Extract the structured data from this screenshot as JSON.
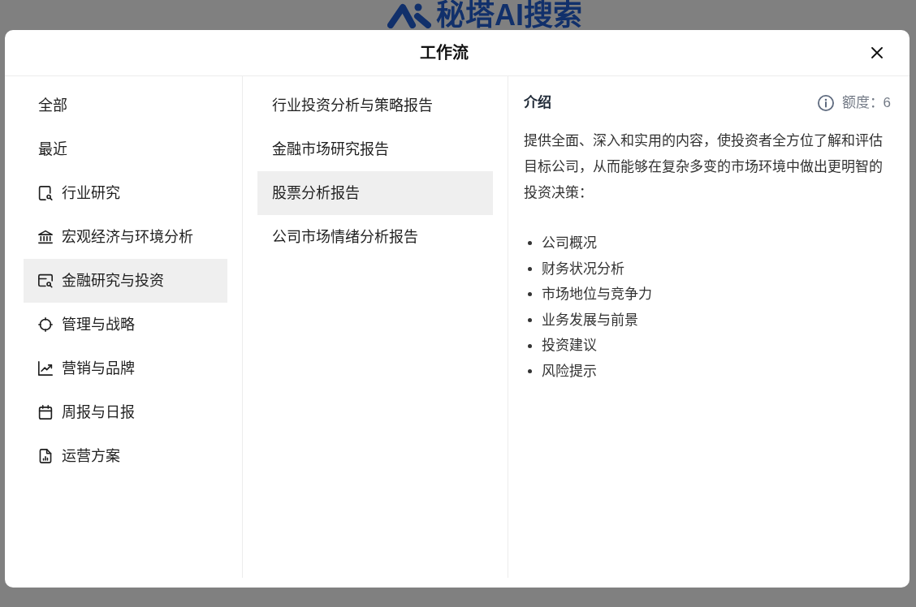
{
  "backdrop": {
    "logo_text": "秘塔AI搜索"
  },
  "dialog": {
    "title": "工作流"
  },
  "categories": [
    {
      "label": "全部",
      "selected": false
    },
    {
      "label": "最近",
      "selected": false
    },
    {
      "label": "行业研究",
      "selected": false
    },
    {
      "label": "宏观经济与环境分析",
      "selected": false
    },
    {
      "label": "金融研究与投资",
      "selected": true
    },
    {
      "label": "管理与战略",
      "selected": false
    },
    {
      "label": "营销与品牌",
      "selected": false
    },
    {
      "label": "周报与日报",
      "selected": false
    },
    {
      "label": "运营方案",
      "selected": false
    }
  ],
  "workflows": [
    {
      "label": "行业投资分析与策略报告",
      "selected": false
    },
    {
      "label": "金融市场研究报告",
      "selected": false
    },
    {
      "label": "股票分析报告",
      "selected": true
    },
    {
      "label": "公司市场情绪分析报告",
      "selected": false
    }
  ],
  "details": {
    "heading": "介绍",
    "quota": "额度：6",
    "description": "提供全面、深入和实用的内容，使投资者全方位了解和评估目标公司，从而能够在复杂多变的市场环境中做出更明智的投资决策：",
    "points": [
      "公司概况",
      "财务状况分析",
      "市场地位与竞争力",
      "业务发展与前景",
      "投资建议",
      "风险提示"
    ]
  }
}
